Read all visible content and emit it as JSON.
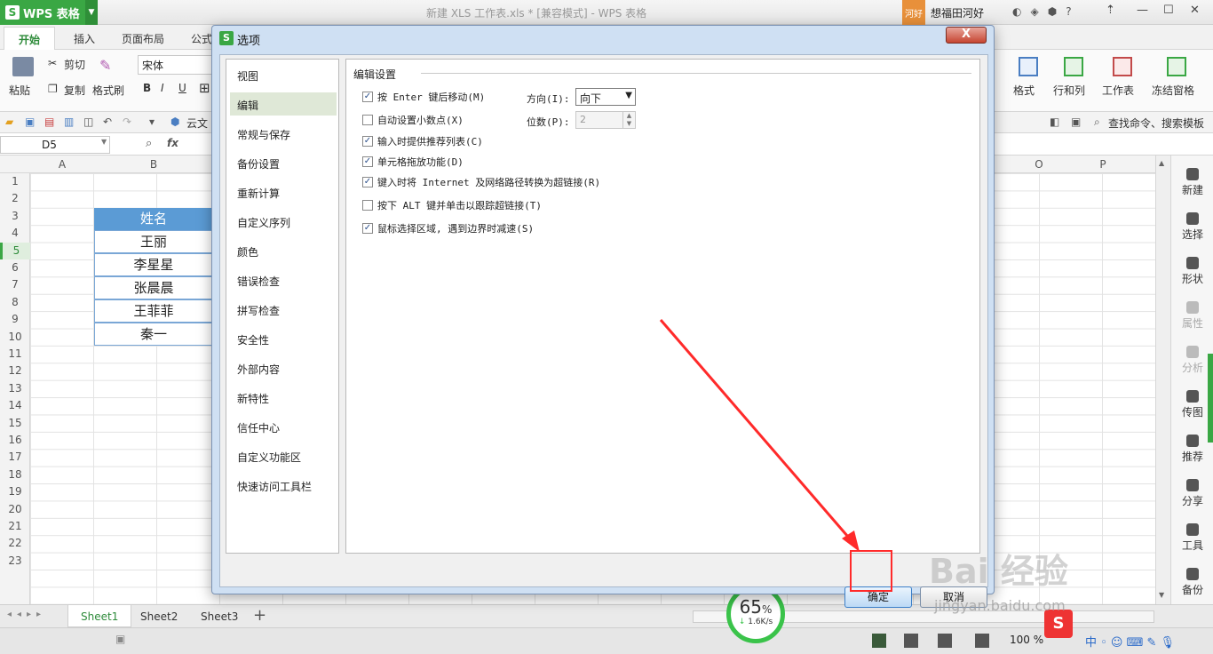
{
  "app": {
    "name": "WPS 表格",
    "doc_title": "新建 XLS 工作表.xls * [兼容模式] - WPS 表格",
    "user_badge": "河好",
    "user_name": "想福田河好"
  },
  "ribbon_tabs": [
    "开始",
    "插入",
    "页面布局",
    "公式"
  ],
  "ribbon": {
    "paste": "粘贴",
    "cut": "剪切",
    "copy": "复制",
    "format_painter": "格式刷",
    "font_name": "宋体",
    "bold": "B",
    "italic": "I",
    "underline": "U",
    "format": "格式",
    "row_col": "行和列",
    "worksheet": "工作表",
    "freeze": "冻结窗格",
    "search": "查找命令、搜索模板",
    "cloud": "云文"
  },
  "formula_bar": {
    "cell_ref": "D5",
    "fx": "fx"
  },
  "columns": [
    "A",
    "B",
    "O",
    "P"
  ],
  "rows": [
    "1",
    "2",
    "3",
    "4",
    "5",
    "6",
    "7",
    "8",
    "9",
    "10",
    "11",
    "12",
    "13",
    "14",
    "15",
    "16",
    "17",
    "18",
    "19",
    "20",
    "21",
    "22",
    "23"
  ],
  "active_row": "5",
  "names_table": {
    "header": "姓名",
    "values": [
      "王丽",
      "李星星",
      "张晨晨",
      "王菲菲",
      "秦一"
    ]
  },
  "sidebar": [
    "新建",
    "选择",
    "形状",
    "属性",
    "分析",
    "传图",
    "推荐",
    "分享",
    "工具",
    "备份"
  ],
  "sheets": [
    "Sheet1",
    "Sheet2",
    "Sheet3"
  ],
  "status": {
    "zoom": "100 %"
  },
  "gauge": {
    "percent": "65",
    "percent_sign": "%",
    "speed": "1.6K/s",
    "value": 0.65
  },
  "dialog": {
    "title": "选项",
    "close": "X",
    "categories": [
      "视图",
      "编辑",
      "常规与保存",
      "备份设置",
      "重新计算",
      "自定义序列",
      "颜色",
      "错误检查",
      "拼写检查",
      "安全性",
      "外部内容",
      "新特性",
      "信任中心",
      "自定义功能区",
      "快速访问工具栏"
    ],
    "active_category": "编辑",
    "section": "编辑设置",
    "options": [
      {
        "label": "按 Enter 键后移动(M)",
        "checked": true
      },
      {
        "label": "自动设置小数点(X)",
        "checked": false
      },
      {
        "label": "输入时提供推荐列表(C)",
        "checked": true
      },
      {
        "label": "单元格拖放功能(D)",
        "checked": true
      },
      {
        "label": "键入时将 Internet 及网络路径转换为超链接(R)",
        "checked": true
      },
      {
        "label": "按下 ALT 键并单击以跟踪超链接(T)",
        "checked": false
      },
      {
        "label": "鼠标选择区域, 遇到边界时减速(S)",
        "checked": true
      }
    ],
    "direction_label": "方向(I):",
    "direction_value": "向下",
    "decimals_label": "位数(P):",
    "decimals_value": "2",
    "ok": "确定",
    "cancel": "取消"
  },
  "watermark": {
    "brand": "Bai 经验",
    "url": "jingyan.baidu.com"
  }
}
